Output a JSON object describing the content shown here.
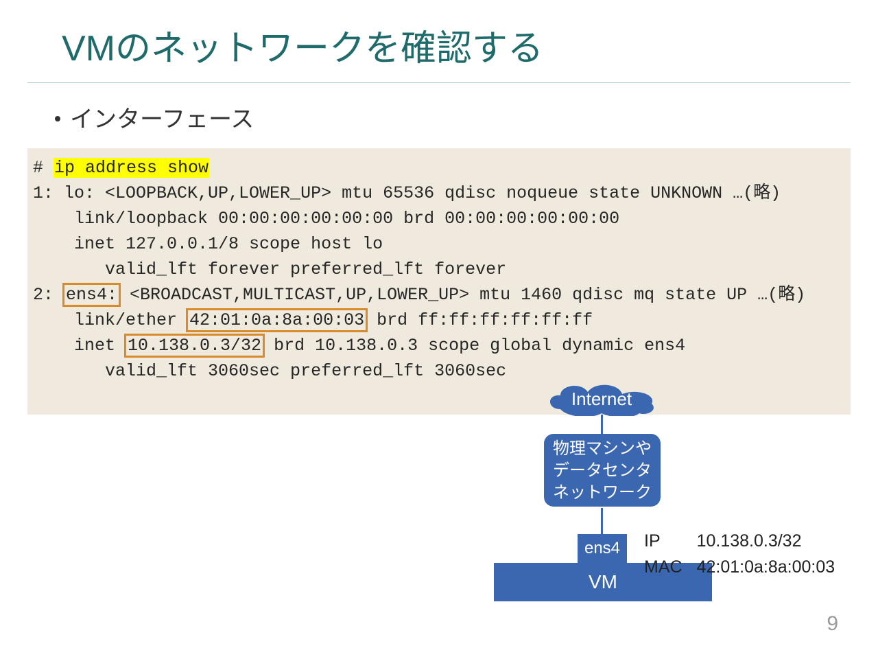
{
  "title": "VMのネットワークを確認する",
  "bullet": "インターフェース",
  "terminal": {
    "prompt": "# ",
    "command": "ip address show",
    "l1a": "1: lo: <LOOPBACK,UP,LOWER_UP> mtu 65536 qdisc noqueue state UNKNOWN …(略)",
    "l1b": "    link/loopback 00:00:00:00:00:00 brd 00:00:00:00:00:00",
    "l1c": "    inet 127.0.0.1/8 scope host lo",
    "l1d": "       valid_lft forever preferred_lft forever",
    "l2_pre": "2: ",
    "l2_if": "ens4:",
    "l2_post": " <BROADCAST,MULTICAST,UP,LOWER_UP> mtu 1460 qdisc mq state UP …(略)",
    "l2b_pre": "    link/ether ",
    "l2b_box": "42:01:0a:8a:00:03",
    "l2b_post": " brd ff:ff:ff:ff:ff:ff",
    "l2c_pre": "    inet ",
    "l2c_box": "10.138.0.3/32",
    "l2c_post": " brd 10.138.0.3 scope global dynamic ens4",
    "l2d": "       valid_lft 3060sec preferred_lft 3060sec"
  },
  "diagram": {
    "internet": "Internet",
    "datacenter_l1": "物理マシンや",
    "datacenter_l2": "データセンタ",
    "datacenter_l3": "ネットワーク",
    "nic": "ens4",
    "vm": "VM",
    "ip_label": "IP",
    "ip_value": "10.138.0.3/32",
    "mac_label": "MAC",
    "mac_value": "42:01:0a:8a:00:03"
  },
  "page": "9"
}
